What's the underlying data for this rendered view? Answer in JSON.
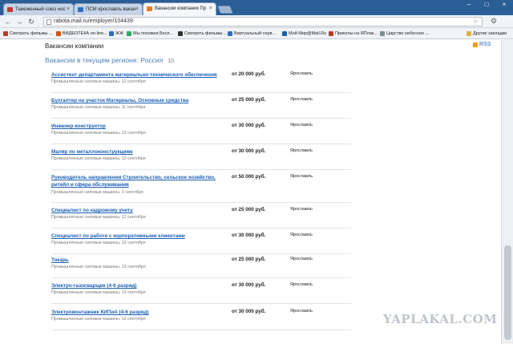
{
  "browser": {
    "tabs": [
      {
        "label": "Таможенный союз нос"
      },
      {
        "label": "ПСМ ярославль вакан"
      },
      {
        "label": "Вакансии компании Пр"
      }
    ],
    "url": "rabota.mail.ru/employer/104439",
    "bookmarks": [
      {
        "label": "Смотреть фильмы ..."
      },
      {
        "label": "ВИДЕОТЕКА on-line..."
      },
      {
        "label": "ЖЖ"
      },
      {
        "label": "Мы похожеи Бесп..."
      },
      {
        "label": "Смотреть фильмы ..."
      },
      {
        "label": "Виртуальный серв..."
      },
      {
        "label": "Мой Мир@Mail.Ru"
      },
      {
        "label": "Приколы на ЯПлак..."
      },
      {
        "label": "Царство небесное ..."
      },
      {
        "label": "Другие закладки"
      }
    ]
  },
  "page": {
    "heading": "Вакансии компании",
    "rss": "RSS",
    "region_title": "Вакансии в текущем регионе: Россия",
    "region_count": "10"
  },
  "vacancies": [
    {
      "title": "Ассистент департамента материально-технического обеспечения",
      "company": "Промышленные силовые машины, 12 сентября",
      "salary": "от 20 000 руб.",
      "city": "Ярославль"
    },
    {
      "title": "Бухгалтер на участок Материалы, Основные средства",
      "company": "Промышленные силовые машины, 11 сентября",
      "salary": "от 25 000 руб.",
      "city": "Ярославль"
    },
    {
      "title": "Инженер-конструктор",
      "company": "Промышленные силовые машины, 13 сентября",
      "salary": "от 30 000 руб.",
      "city": "Ярославль"
    },
    {
      "title": "Маляр по металлоконструкциям",
      "company": "Промышленные силовые машины, 12 сентября",
      "salary": "от 30 000 руб.",
      "city": "Ярославль"
    },
    {
      "title": "Руководитель направления Строительство, сельское хозяйство, ритейл и сфера обслуживания",
      "company": "Промышленные силовые машины, 3 сентября",
      "salary": "от 50 000 руб.",
      "city": "Ярославль"
    },
    {
      "title": "Специалист по кадровому учету",
      "company": "Промышленные силовые машины, 12 сентября",
      "salary": "от 25 000 руб.",
      "city": "Ярославль"
    },
    {
      "title": "Специалист по работе с корпоративными клиентами",
      "company": "Промышленные силовые машины, 12 сентября",
      "salary": "от 30 000 руб.",
      "city": "Ярославль"
    },
    {
      "title": "Токарь",
      "company": "Промышленные силовые машины, 13 сентября",
      "salary": "от 25 000 руб.",
      "city": "Ярославль"
    },
    {
      "title": "Электро-газосварщик (4-6 разряд)",
      "company": "Промышленные силовые машины, 13 сентября",
      "salary": "от 30 000 руб.",
      "city": "Ярославль"
    },
    {
      "title": "Электромонтажник КИПиА (4-6 разряд)",
      "company": "Промышленные силовые машины, 12 сентября",
      "salary": "от 30 000 руб.",
      "city": "Ярославль"
    }
  ],
  "watermark": "YAPLAKAL.COM",
  "colors": {
    "link": "#1a5fb4",
    "tabbar": "#2c5e96",
    "watermark": "#bfc5cc"
  }
}
